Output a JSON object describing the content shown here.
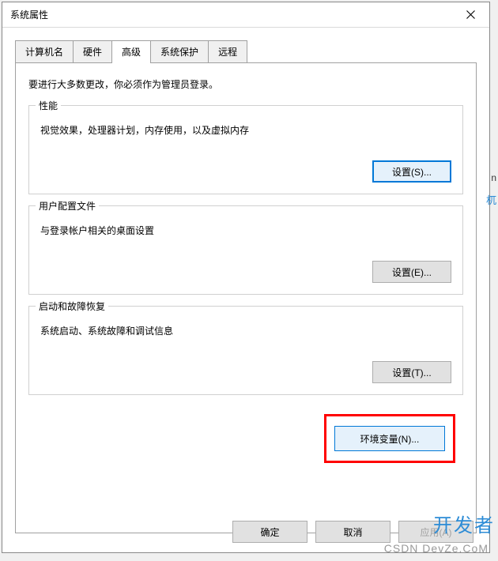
{
  "window": {
    "title": "系统属性"
  },
  "tabs": [
    {
      "label": "计算机名"
    },
    {
      "label": "硬件"
    },
    {
      "label": "高级"
    },
    {
      "label": "系统保护"
    },
    {
      "label": "远程"
    }
  ],
  "panel": {
    "admin_note": "要进行大多数更改，你必须作为管理员登录。",
    "performance": {
      "title": "性能",
      "desc": "视觉效果，处理器计划，内存使用，以及虚拟内存",
      "settings_btn": "设置(S)..."
    },
    "user_profiles": {
      "title": "用户配置文件",
      "desc": "与登录帐户相关的桌面设置",
      "settings_btn": "设置(E)..."
    },
    "startup": {
      "title": "启动和故障恢复",
      "desc": "系统启动、系统故障和调试信息",
      "settings_btn": "设置(T)..."
    },
    "env_btn": "环境变量(N)..."
  },
  "bottom": {
    "ok": "确定",
    "cancel": "取消",
    "apply": "应用(A)"
  },
  "watermark": {
    "brand": "开发者",
    "site": "CSDN DevZe.CoM"
  },
  "side": {
    "t1": "n",
    "t2": "杌"
  }
}
